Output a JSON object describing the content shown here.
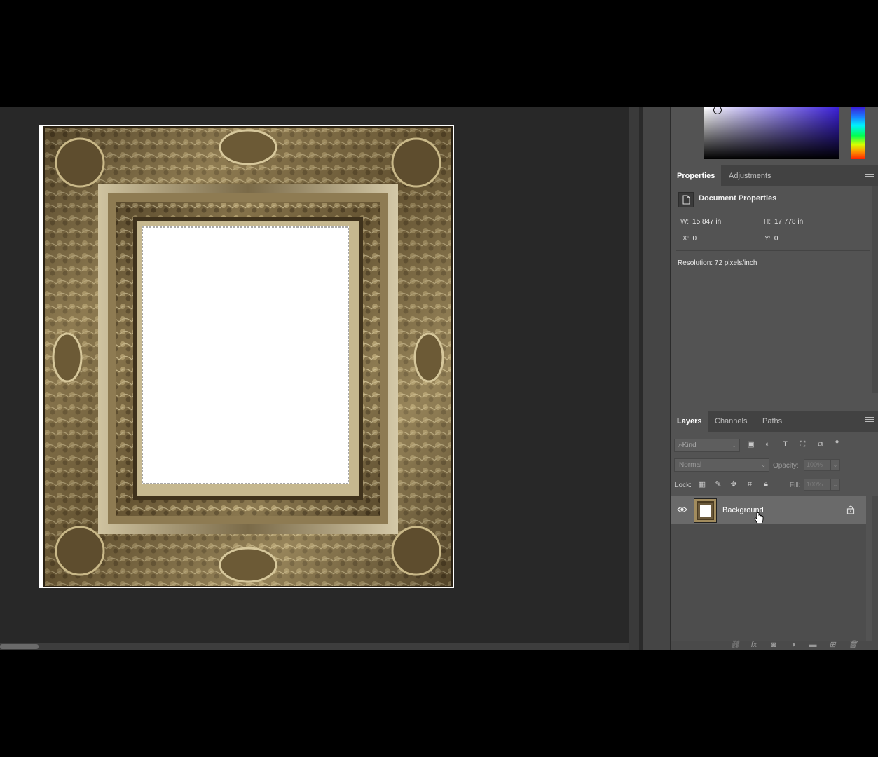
{
  "app": {
    "name": "Photoshop"
  },
  "properties_panel": {
    "tabs": [
      {
        "label": "Properties",
        "active": true
      },
      {
        "label": "Adjustments",
        "active": false
      }
    ],
    "title": "Document Properties",
    "width_label": "W:",
    "width_value": "15.847 in",
    "height_label": "H:",
    "height_value": "17.778 in",
    "x_label": "X:",
    "x_value": "0",
    "y_label": "Y:",
    "y_value": "0",
    "resolution": "Resolution: 72 pixels/inch"
  },
  "layers_panel": {
    "tabs": [
      {
        "label": "Layers",
        "active": true
      },
      {
        "label": "Channels",
        "active": false
      },
      {
        "label": "Paths",
        "active": false
      }
    ],
    "filter_kind": "Kind",
    "blend_mode": "Normal",
    "opacity_label": "Opacity:",
    "opacity_value": "100%",
    "lock_label": "Lock:",
    "fill_label": "Fill:",
    "fill_value": "100%",
    "layers": [
      {
        "name": "Background",
        "visible": true,
        "locked": true
      }
    ]
  },
  "colors": {
    "panel_bg": "#535353",
    "workspace_bg": "#282828",
    "color_picker_hue": "#3a1fd8",
    "frame_gold": "#a28c5e"
  }
}
